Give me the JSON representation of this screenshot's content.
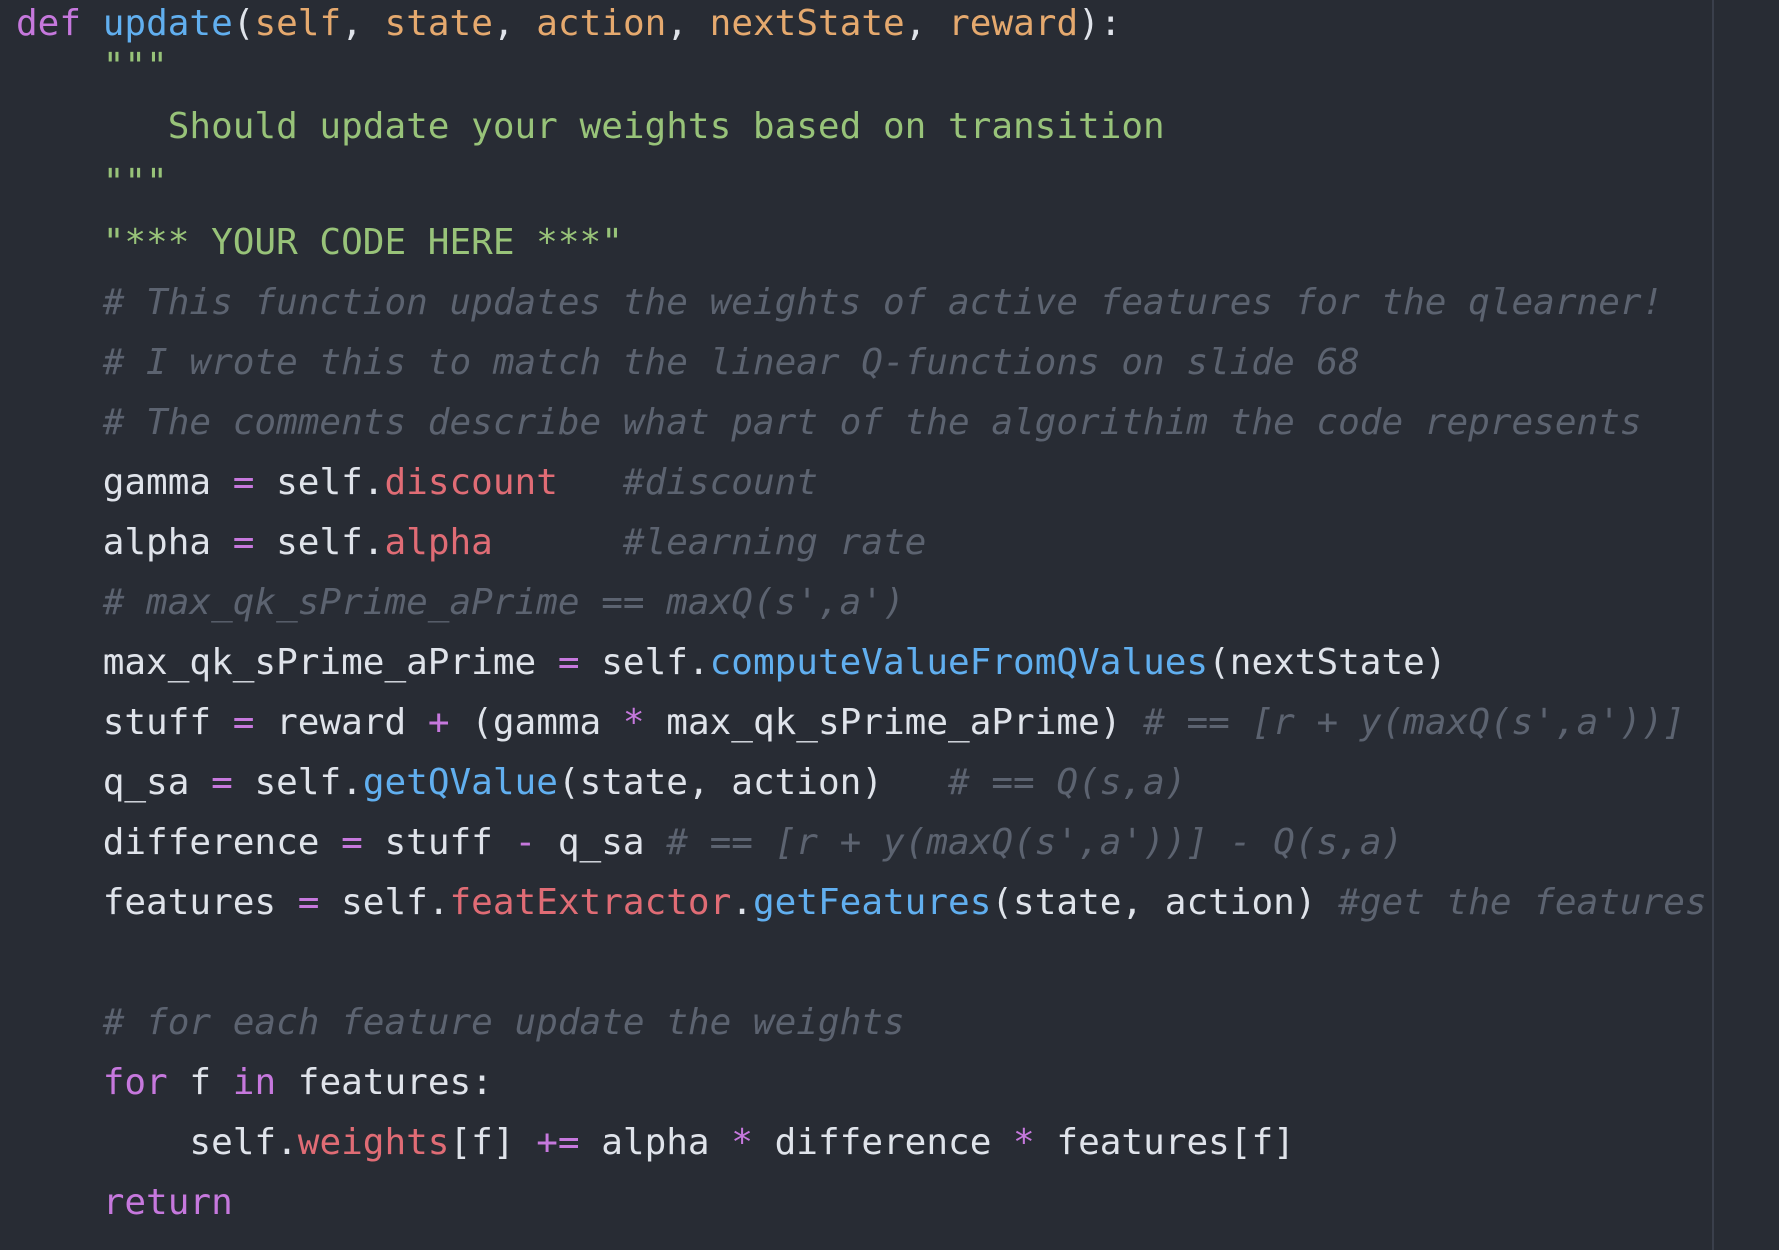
{
  "editor": {
    "theme_colors": {
      "background": "#282c34",
      "keyword": "#c678dd",
      "function": "#61afef",
      "parameter": "#e5a96e",
      "string": "#98c379",
      "comment": "#5c6370",
      "attribute": "#e06c75",
      "text": "#dfe3ea"
    },
    "lines": [
      {
        "kind": "first",
        "tokens": [
          {
            "t": "kw",
            "v": "def"
          },
          {
            "t": "tx",
            "v": " "
          },
          {
            "t": "fn",
            "v": "update"
          },
          {
            "t": "tx",
            "v": "("
          },
          {
            "t": "param",
            "v": "self"
          },
          {
            "t": "tx",
            "v": ", "
          },
          {
            "t": "param",
            "v": "state"
          },
          {
            "t": "tx",
            "v": ", "
          },
          {
            "t": "param",
            "v": "action"
          },
          {
            "t": "tx",
            "v": ", "
          },
          {
            "t": "param",
            "v": "nextState"
          },
          {
            "t": "tx",
            "v": ", "
          },
          {
            "t": "param",
            "v": "reward"
          },
          {
            "t": "tx",
            "v": "):"
          }
        ]
      },
      {
        "kind": "dq",
        "tokens": [
          {
            "t": "str",
            "v": "    \"\"\""
          }
        ]
      },
      {
        "tokens": [
          {
            "t": "str",
            "v": "       Should update your weights based on transition"
          }
        ]
      },
      {
        "kind": "dq",
        "tokens": [
          {
            "t": "str",
            "v": "    \"\"\""
          }
        ]
      },
      {
        "tokens": [
          {
            "t": "str",
            "v": "    \"*** YOUR CODE HERE ***\""
          }
        ]
      },
      {
        "tokens": [
          {
            "t": "cm",
            "v": "    # This function updates the weights of active features for the qlearner!"
          }
        ]
      },
      {
        "tokens": [
          {
            "t": "cm",
            "v": "    # I wrote this to match the linear Q-functions on slide 68"
          }
        ]
      },
      {
        "tokens": [
          {
            "t": "cm",
            "v": "    # The comments describe what part of the algorithim the code represents"
          }
        ]
      },
      {
        "tokens": [
          {
            "t": "tx",
            "v": "    gamma "
          },
          {
            "t": "op",
            "v": "="
          },
          {
            "t": "tx",
            "v": " self."
          },
          {
            "t": "attr",
            "v": "discount"
          },
          {
            "t": "tx",
            "v": "   "
          },
          {
            "t": "cm",
            "v": "#discount"
          }
        ]
      },
      {
        "tokens": [
          {
            "t": "tx",
            "v": "    alpha "
          },
          {
            "t": "op",
            "v": "="
          },
          {
            "t": "tx",
            "v": " self."
          },
          {
            "t": "attr",
            "v": "alpha"
          },
          {
            "t": "tx",
            "v": "      "
          },
          {
            "t": "cm",
            "v": "#learning rate"
          }
        ]
      },
      {
        "tokens": [
          {
            "t": "cm",
            "v": "    # max_qk_sPrime_aPrime == maxQ(s',a')"
          }
        ]
      },
      {
        "tokens": [
          {
            "t": "tx",
            "v": "    max_qk_sPrime_aPrime "
          },
          {
            "t": "op",
            "v": "="
          },
          {
            "t": "tx",
            "v": " self."
          },
          {
            "t": "fn",
            "v": "computeValueFromQValues"
          },
          {
            "t": "tx",
            "v": "(nextState)"
          }
        ]
      },
      {
        "tokens": [
          {
            "t": "tx",
            "v": "    stuff "
          },
          {
            "t": "op",
            "v": "="
          },
          {
            "t": "tx",
            "v": " reward "
          },
          {
            "t": "op",
            "v": "+"
          },
          {
            "t": "tx",
            "v": " (gamma "
          },
          {
            "t": "op",
            "v": "*"
          },
          {
            "t": "tx",
            "v": " max_qk_sPrime_aPrime) "
          },
          {
            "t": "cm",
            "v": "# == [r + y(maxQ(s',a'))]"
          }
        ]
      },
      {
        "tokens": [
          {
            "t": "tx",
            "v": "    q_sa "
          },
          {
            "t": "op",
            "v": "="
          },
          {
            "t": "tx",
            "v": " self."
          },
          {
            "t": "fn",
            "v": "getQValue"
          },
          {
            "t": "tx",
            "v": "(state, action)   "
          },
          {
            "t": "cm",
            "v": "# == Q(s,a)"
          }
        ]
      },
      {
        "tokens": [
          {
            "t": "tx",
            "v": "    difference "
          },
          {
            "t": "op",
            "v": "="
          },
          {
            "t": "tx",
            "v": " stuff "
          },
          {
            "t": "op",
            "v": "-"
          },
          {
            "t": "tx",
            "v": " q_sa "
          },
          {
            "t": "cm",
            "v": "# == [r + y(maxQ(s',a'))] - Q(s,a)"
          }
        ]
      },
      {
        "tokens": [
          {
            "t": "tx",
            "v": "    features "
          },
          {
            "t": "op",
            "v": "="
          },
          {
            "t": "tx",
            "v": " self."
          },
          {
            "t": "attr",
            "v": "featExtractor"
          },
          {
            "t": "tx",
            "v": "."
          },
          {
            "t": "fn",
            "v": "getFeatures"
          },
          {
            "t": "tx",
            "v": "(state, action) "
          },
          {
            "t": "cm",
            "v": "#get the features"
          }
        ]
      },
      {
        "tokens": [
          {
            "t": "tx",
            "v": ""
          }
        ]
      },
      {
        "tokens": [
          {
            "t": "cm",
            "v": "    # for each feature update the weights"
          }
        ]
      },
      {
        "tokens": [
          {
            "t": "tx",
            "v": "    "
          },
          {
            "t": "kw",
            "v": "for"
          },
          {
            "t": "tx",
            "v": " f "
          },
          {
            "t": "kw",
            "v": "in"
          },
          {
            "t": "tx",
            "v": " features:"
          }
        ]
      },
      {
        "tokens": [
          {
            "t": "tx",
            "v": "        self."
          },
          {
            "t": "attr",
            "v": "weights"
          },
          {
            "t": "tx",
            "v": "[f] "
          },
          {
            "t": "op",
            "v": "+="
          },
          {
            "t": "tx",
            "v": " alpha "
          },
          {
            "t": "op",
            "v": "*"
          },
          {
            "t": "tx",
            "v": " difference "
          },
          {
            "t": "op",
            "v": "*"
          },
          {
            "t": "tx",
            "v": " features[f]"
          }
        ]
      },
      {
        "tokens": [
          {
            "t": "tx",
            "v": "    "
          },
          {
            "t": "kw",
            "v": "return"
          }
        ]
      }
    ]
  }
}
